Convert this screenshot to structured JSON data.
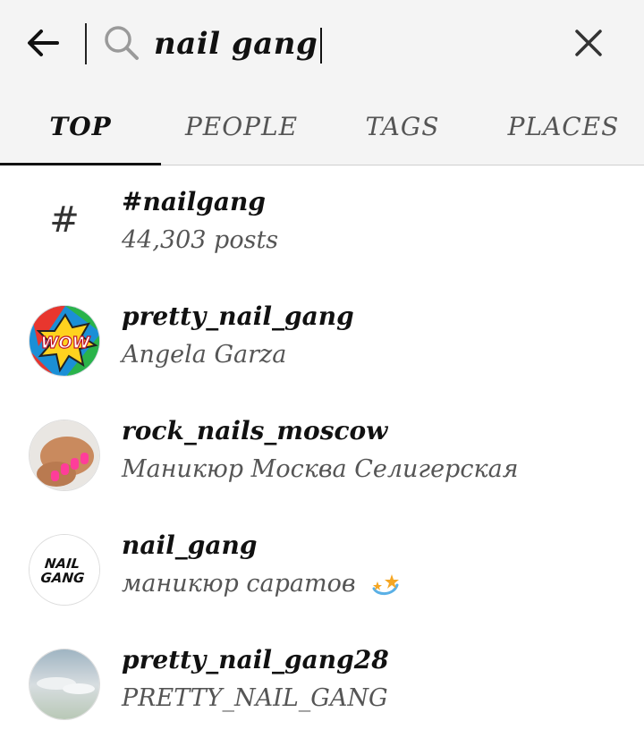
{
  "search": {
    "query": "nail gang"
  },
  "tabs": [
    {
      "label": "TOP",
      "active": true
    },
    {
      "label": "PEOPLE",
      "active": false
    },
    {
      "label": "TAGS",
      "active": false
    },
    {
      "label": "PLACES",
      "active": false
    }
  ],
  "results": [
    {
      "type": "hashtag",
      "title": "#nailgang",
      "subtitle": "44,303 posts",
      "icon": "hashtag-icon"
    },
    {
      "type": "user",
      "title": "pretty_nail_gang",
      "subtitle": "Angela Garza",
      "avatar": "wow-comic-avatar"
    },
    {
      "type": "user",
      "title": "rock_nails_moscow",
      "subtitle": "Маникюр Москва Селигерская",
      "avatar": "pink-nails-hand-avatar"
    },
    {
      "type": "user",
      "title": "nail_gang",
      "subtitle": "маникюр саратов",
      "avatar": "nail-gang-logo-avatar",
      "avatar_text": "NAIL GANG",
      "subtitle_icon": "dizzy-stars-icon"
    },
    {
      "type": "user",
      "title": "pretty_nail_gang28",
      "subtitle": "PRETTY_NAIL_GANG",
      "avatar": "sky-clouds-avatar"
    }
  ],
  "colors": {
    "header_bg": "#f4f4f4",
    "text_primary": "#111111",
    "text_secondary": "#555555",
    "accent_pink": "#ff3d9a"
  }
}
